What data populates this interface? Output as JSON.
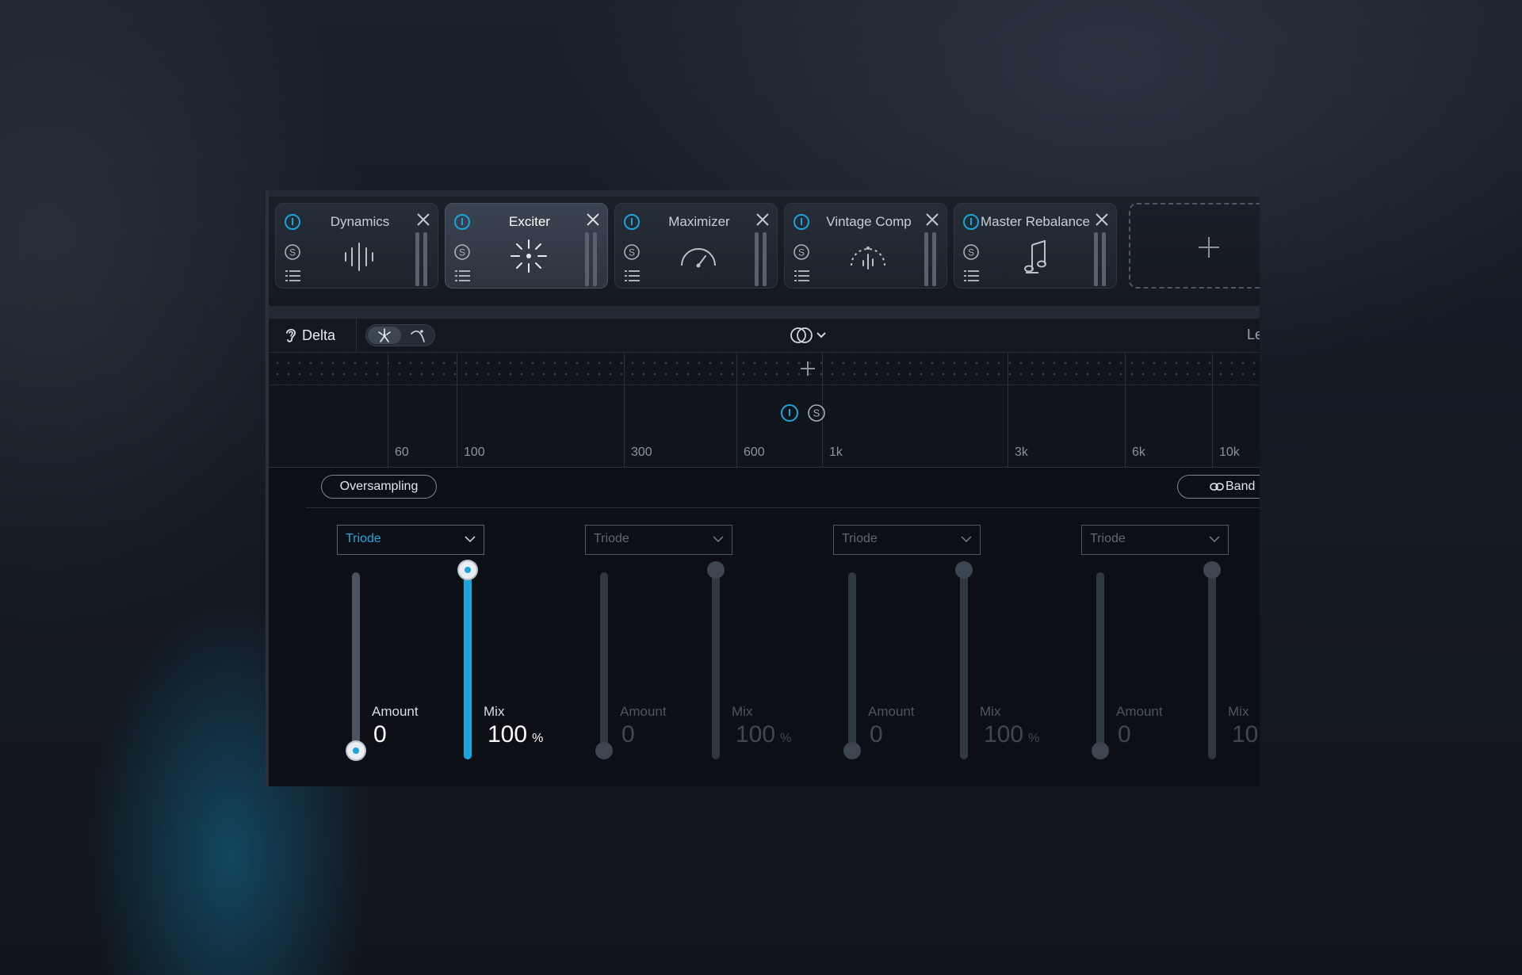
{
  "modules": [
    {
      "title": "Dynamics",
      "icon": "dynamics-waveform-icon",
      "active": false
    },
    {
      "title": "Exciter",
      "icon": "exciter-sparkle-icon",
      "active": true
    },
    {
      "title": "Maximizer",
      "icon": "maximizer-gauge-icon",
      "active": false
    },
    {
      "title": "Vintage Comp",
      "icon": "vintage-comp-meter-icon",
      "active": false
    },
    {
      "title": "Master Rebalance",
      "icon": "music-note-icon",
      "active": false
    }
  ],
  "toolbar": {
    "delta_label": "Delta",
    "right_label": "Le"
  },
  "spectrum": {
    "freq_labels": [
      "60",
      "100",
      "300",
      "600",
      "1k",
      "3k",
      "6k",
      "10k"
    ]
  },
  "controls": {
    "oversampling_label": "Oversampling",
    "band_link_label": "Band"
  },
  "bands": [
    {
      "mode": "Triode",
      "amount_label": "Amount",
      "amount_value": "0",
      "mix_label": "Mix",
      "mix_value": "100",
      "mix_unit": "%",
      "amount": 0,
      "mix": 100,
      "enabled": true
    },
    {
      "mode": "Triode",
      "amount_label": "Amount",
      "amount_value": "0",
      "mix_label": "Mix",
      "mix_value": "100",
      "mix_unit": "%",
      "amount": 0,
      "mix": 100,
      "enabled": false
    },
    {
      "mode": "Triode",
      "amount_label": "Amount",
      "amount_value": "0",
      "mix_label": "Mix",
      "mix_value": "100",
      "mix_unit": "%",
      "amount": 0,
      "mix": 100,
      "enabled": false
    },
    {
      "mode": "Triode",
      "amount_label": "Amount",
      "amount_value": "0",
      "mix_label": "Mix",
      "mix_value": "10",
      "mix_unit": "",
      "amount": 0,
      "mix": 100,
      "enabled": false
    }
  ],
  "colors": {
    "accent": "#1aa4dc",
    "panel_bg": "#0c1016"
  }
}
